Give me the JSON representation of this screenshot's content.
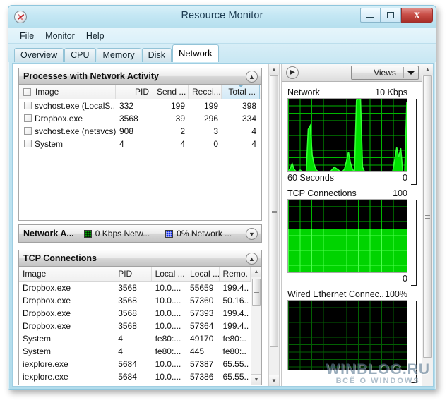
{
  "window": {
    "title": "Resource Monitor",
    "app_icon": "resource-monitor-icon",
    "minimize_label": "—",
    "maximize_label": "❐",
    "close_label": "X"
  },
  "menu": {
    "items": [
      "File",
      "Monitor",
      "Help"
    ]
  },
  "tabs": {
    "items": [
      "Overview",
      "CPU",
      "Memory",
      "Disk",
      "Network"
    ],
    "active": "Network"
  },
  "processes_panel": {
    "title": "Processes with Network Activity",
    "collapse_icon": "chevron-up-icon",
    "columns": [
      "Image",
      "PID",
      "Send ...",
      "Recei...",
      "Total ..."
    ],
    "sorted_column": "Total ...",
    "sort_direction": "descending",
    "rows": [
      {
        "image": "svchost.exe (LocalS...",
        "pid": "332",
        "send": "199",
        "receive": "199",
        "total": "398"
      },
      {
        "image": "Dropbox.exe",
        "pid": "3568",
        "send": "39",
        "receive": "296",
        "total": "334"
      },
      {
        "image": "svchost.exe (netsvcs)",
        "pid": "908",
        "send": "2",
        "receive": "3",
        "total": "4"
      },
      {
        "image": "System",
        "pid": "4",
        "send": "4",
        "receive": "0",
        "total": "4"
      }
    ]
  },
  "network_activity_bar": {
    "title": "Network A...",
    "expand_icon": "chevron-down-icon",
    "legend": [
      {
        "swatch": "green",
        "color": "#009c00",
        "label": "0 Kbps Netw..."
      },
      {
        "swatch": "blue",
        "color": "#0a24e8",
        "label": "0% Network ..."
      }
    ]
  },
  "tcp_panel": {
    "title": "TCP Connections",
    "collapse_icon": "chevron-up-icon",
    "columns": [
      "Image",
      "PID",
      "Local ...",
      "Local ...",
      "Remo."
    ],
    "rows": [
      {
        "image": "Dropbox.exe",
        "pid": "3568",
        "local_address": "10.0....",
        "local_port": "55659",
        "remote": "199.4.."
      },
      {
        "image": "Dropbox.exe",
        "pid": "3568",
        "local_address": "10.0....",
        "local_port": "57360",
        "remote": "50.16.."
      },
      {
        "image": "Dropbox.exe",
        "pid": "3568",
        "local_address": "10.0....",
        "local_port": "57393",
        "remote": "199.4.."
      },
      {
        "image": "Dropbox.exe",
        "pid": "3568",
        "local_address": "10.0....",
        "local_port": "57364",
        "remote": "199.4.."
      },
      {
        "image": "System",
        "pid": "4",
        "local_address": "fe80:...",
        "local_port": "49170",
        "remote": "fe80:.."
      },
      {
        "image": "System",
        "pid": "4",
        "local_address": "fe80:...",
        "local_port": "445",
        "remote": "fe80:.."
      },
      {
        "image": "iexplore.exe",
        "pid": "5684",
        "local_address": "10.0....",
        "local_port": "57387",
        "remote": "65.55.."
      },
      {
        "image": "iexplore.exe",
        "pid": "5684",
        "local_address": "10.0....",
        "local_port": "57386",
        "remote": "65.55.."
      }
    ]
  },
  "graph_toolbar": {
    "expand_icon": "chevron-right-icon",
    "views_label": "Views",
    "views_caret_icon": "caret-down-icon"
  },
  "graphs": [
    {
      "name": "Network",
      "max_label": "10 Kbps",
      "min_label": "0",
      "time_label": "60 Seconds",
      "style": "line",
      "fill_percent": 0
    },
    {
      "name": "TCP Connections",
      "max_label": "100",
      "min_label": "0",
      "time_label": "",
      "style": "area",
      "fill_percent": 60
    },
    {
      "name": "Wired Ethernet Connec...",
      "max_label": "100%",
      "min_label": "",
      "time_label": "",
      "style": "empty",
      "fill_percent": 0
    }
  ],
  "chart_data": {
    "type": "area",
    "title": "Network",
    "ylabel": "Kbps",
    "xlabel": "60 Seconds",
    "ylim": [
      0,
      10
    ],
    "x": [
      0,
      1,
      2,
      3,
      4,
      5,
      6,
      7,
      8,
      9,
      10,
      11,
      12,
      13,
      14,
      15,
      16,
      17,
      18,
      19,
      20,
      21,
      22,
      23,
      24,
      25,
      26,
      27,
      28,
      29,
      30,
      31,
      32,
      33,
      34,
      35,
      36,
      37,
      38,
      39,
      40,
      41,
      42,
      43,
      44,
      45,
      46,
      47,
      48,
      49,
      50,
      51,
      52,
      53,
      54,
      55,
      56,
      57,
      58,
      59
    ],
    "values": [
      0,
      0.4,
      1.1,
      0.3,
      0,
      0,
      0.2,
      0,
      0,
      0,
      5.8,
      6.3,
      2.2,
      0.9,
      0.2,
      0,
      0,
      0,
      0,
      0,
      0,
      0,
      0.3,
      0.6,
      0.4,
      0.2,
      0,
      0,
      0.3,
      1.4,
      2.7,
      1.2,
      0.3,
      0,
      9.8,
      10,
      9.9,
      0.6,
      0,
      0,
      0,
      0,
      0,
      0,
      0,
      0,
      0,
      0,
      0,
      0,
      0,
      0,
      0,
      1.6,
      3.3,
      2.0,
      3.2,
      0,
      0,
      9.6
    ],
    "grid": true,
    "legend": []
  },
  "watermark": {
    "line1": "WINBLOG.RU",
    "line2": "ВСЁ О WINDOWS"
  },
  "scrollbars": {
    "up_arrow_icon": "triangle-up-icon",
    "down_arrow_icon": "triangle-down-icon"
  }
}
